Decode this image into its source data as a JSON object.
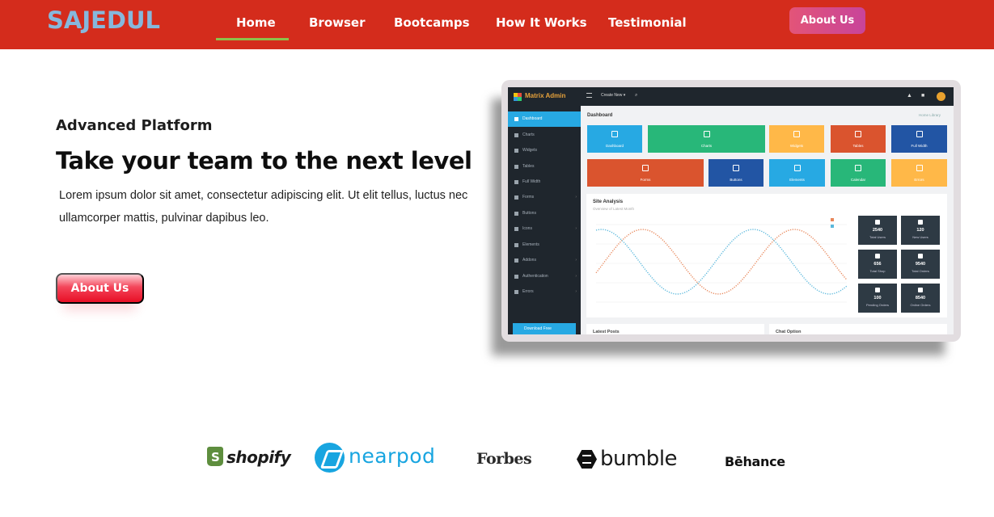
{
  "navbar": {
    "brand": "SAJEDUL",
    "links": [
      "Home",
      "Browser",
      "Bootcamps",
      "How It Works",
      "Testimonial"
    ],
    "active_link": "Home",
    "cta": "About Us",
    "colors": {
      "background": "#d42c1c",
      "brand": "#86b8dc",
      "active_underline": "#8dc14a"
    }
  },
  "hero": {
    "eyebrow": "Advanced Platform",
    "headline": "Take your team to the next level",
    "body": "Lorem ipsum dolor sit amet, consectetur adipiscing elit. Ut elit tellus, luctus nec ullamcorper mattis, pulvinar dapibus leo.",
    "cta": "About Us"
  },
  "mockup": {
    "brand": "Matrix Admin",
    "create_new": "Create New ▾",
    "page_title": "Dashboard",
    "breadcrumb": "Home   Library",
    "sidebar": [
      "Dashboard",
      "Charts",
      "Widgets",
      "Tables",
      "Full Width",
      "Forms",
      "Buttons",
      "Icons",
      "Elements",
      "Addons",
      "Authentication",
      "Errors"
    ],
    "sidebar_download": "Download Free",
    "tiles_row1": [
      {
        "label": "Dashboard",
        "color": "#27a9e3"
      },
      {
        "label": "Charts",
        "color": "#28b779"
      },
      {
        "label": "Widgets",
        "color": "#ffb848"
      },
      {
        "label": "Tables",
        "color": "#da542e"
      },
      {
        "label": "Full Width",
        "color": "#2255a4"
      }
    ],
    "tiles_row2": [
      {
        "label": "Forms",
        "color": "#da542e"
      },
      {
        "label": "Buttons",
        "color": "#2255a4"
      },
      {
        "label": "Elements",
        "color": "#27a9e3"
      },
      {
        "label": "Calendar",
        "color": "#28b779"
      },
      {
        "label": "Errors",
        "color": "#ffb848"
      }
    ],
    "analysis_title": "Site Analysis",
    "analysis_subtitle": "Overview of Latest Month",
    "stats": [
      {
        "value": "2540",
        "label": "Total Users"
      },
      {
        "value": "120",
        "label": "New Users"
      },
      {
        "value": "656",
        "label": "Total Shop"
      },
      {
        "value": "9540",
        "label": "Total Orders"
      },
      {
        "value": "100",
        "label": "Pending Orders"
      },
      {
        "value": "8540",
        "label": "Online Orders"
      }
    ],
    "bottom_cards": [
      "Latest Posts",
      "Chat Option"
    ]
  },
  "logos": {
    "shopify": "shopify",
    "nearpod": "nearpod",
    "forbes": "Forbes",
    "bumble": "bumble",
    "behance": "Bēhance"
  }
}
